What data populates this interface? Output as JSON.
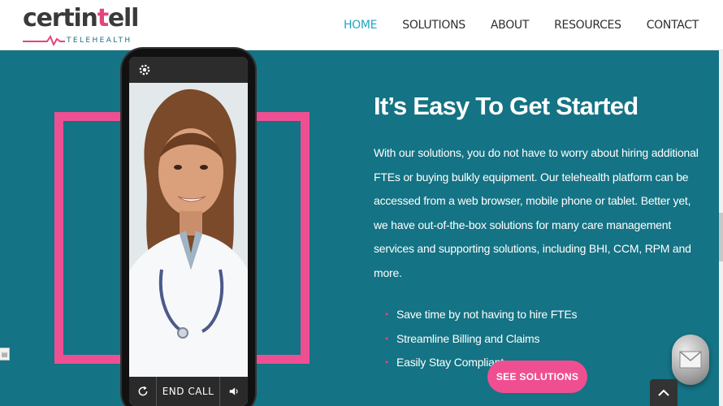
{
  "brand": {
    "name_part1": "certin",
    "name_part2": "t",
    "name_part3": "ell",
    "tagline": "TELEHEALTH",
    "colors": {
      "primary": "#147384",
      "accent": "#ee4f93",
      "nav_active": "#1fa6c2"
    }
  },
  "nav": {
    "items": [
      {
        "label": "HOME",
        "active": true
      },
      {
        "label": "SOLUTIONS",
        "active": false
      },
      {
        "label": "ABOUT",
        "active": false
      },
      {
        "label": "RESOURCES",
        "active": false
      },
      {
        "label": "CONTACT",
        "active": false
      }
    ]
  },
  "phone": {
    "end_call_label": "END CALL",
    "icons": {
      "settings": "gear-icon",
      "rotate": "rotate-camera-icon",
      "volume": "speaker-icon"
    }
  },
  "hero": {
    "title": "It’s Easy To Get Started",
    "description": "With our solutions, you do not have to worry about hiring additional FTEs or buying bulkly equipment. Our telehealth platform can be accessed from a web browser, mobile phone or tablet. Better yet, we have out-of-the-box solutions for many care management services and supporting solutions, including BHI, CCM, RPM and more.",
    "bullets": [
      "Save time by not having to hire FTEs",
      "Streamline Billing and Claims",
      "Easily Stay Compliant"
    ],
    "cta_label": "SEE SOLUTIONS"
  },
  "widgets": {
    "scroll_top_icon": "chevron-up-icon",
    "chat_icon": "mail-icon"
  }
}
